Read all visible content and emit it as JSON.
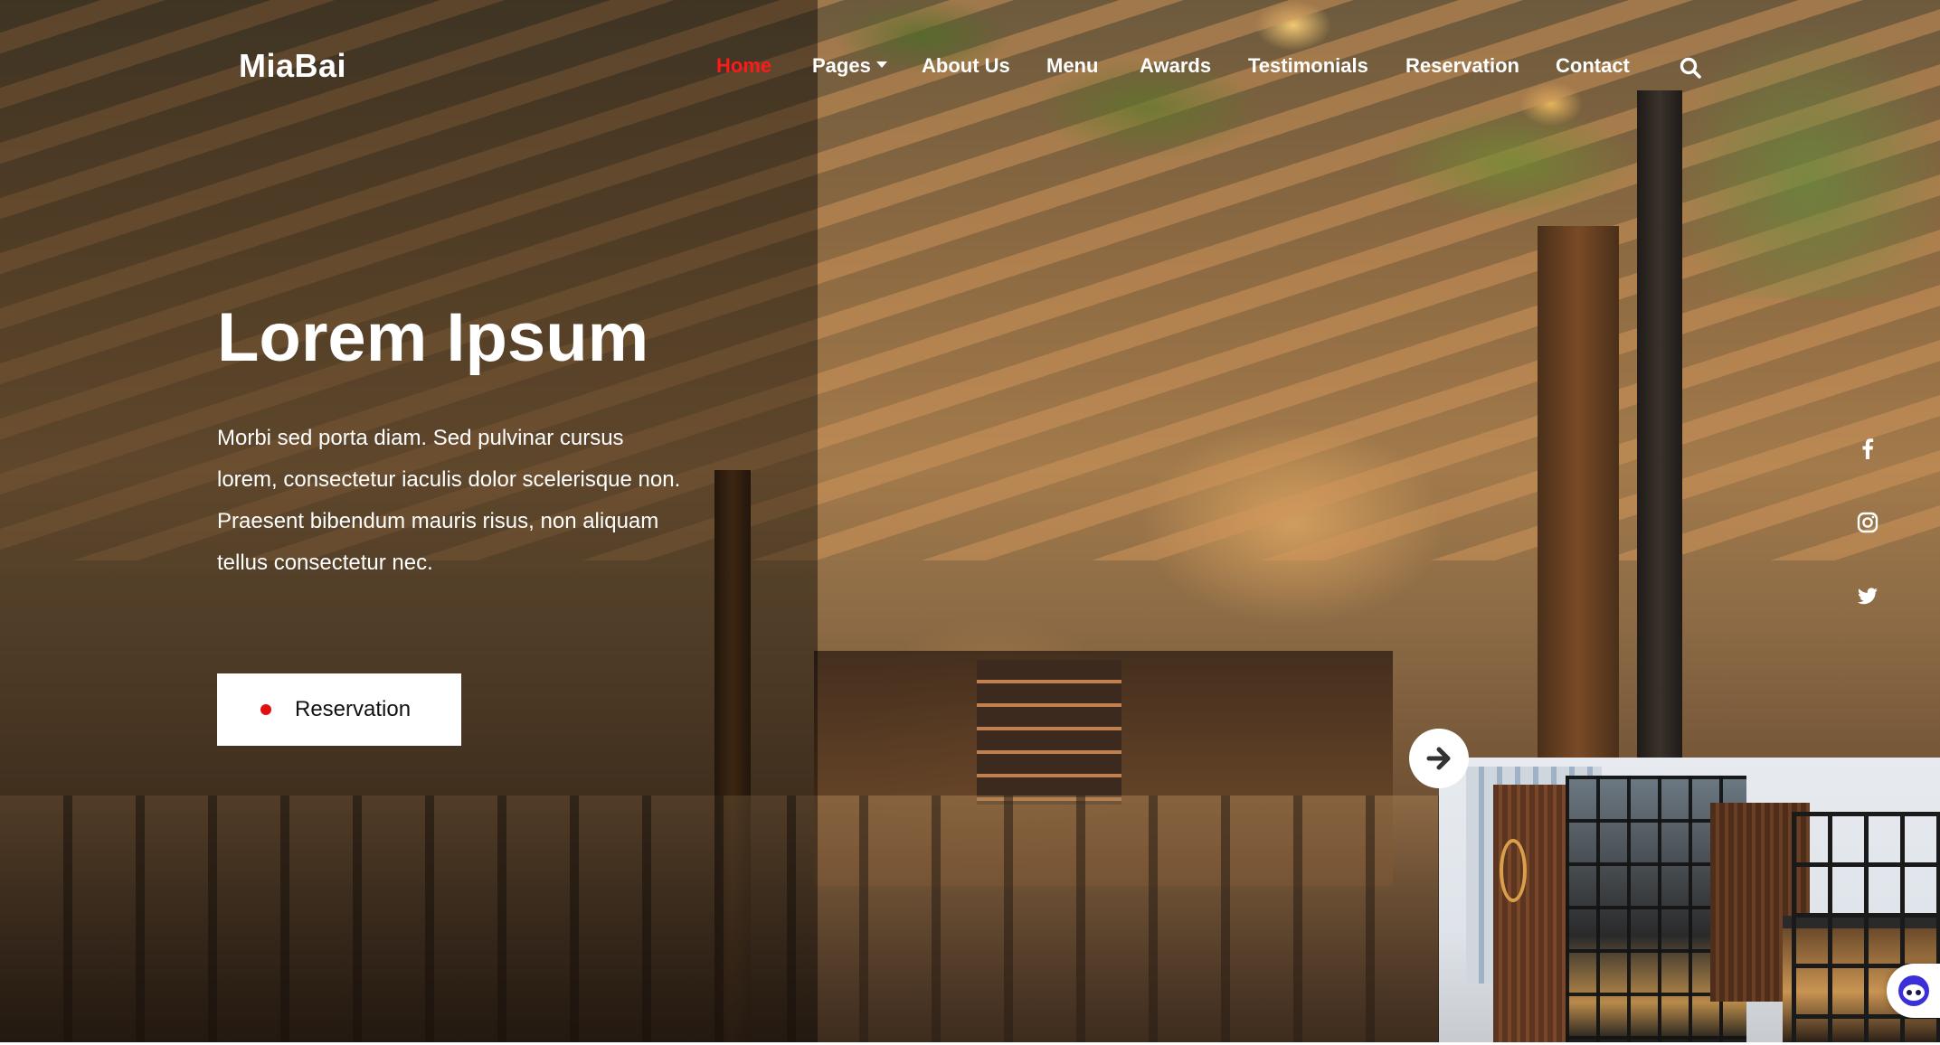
{
  "brand": {
    "logo": "MiaBai"
  },
  "nav": {
    "items": [
      {
        "label": "Home",
        "active": true
      },
      {
        "label": "Pages",
        "dropdown": true
      },
      {
        "label": "About Us"
      },
      {
        "label": "Menu"
      },
      {
        "label": "Awards"
      },
      {
        "label": "Testimonials"
      },
      {
        "label": "Reservation"
      },
      {
        "label": "Contact"
      }
    ],
    "search_icon": "search-icon"
  },
  "hero": {
    "title": "Lorem Ipsum",
    "text": "Morbi sed porta diam. Sed pulvinar cursus lorem, consectetur iaculis dolor scelerisque non. Praesent bibendum mauris risus, non aliquam tellus consectetur nec.",
    "button_label": "Reservation"
  },
  "social": {
    "icons": [
      "facebook-icon",
      "instagram-icon",
      "twitter-icon"
    ]
  },
  "slider": {
    "next_icon": "arrow-right-icon",
    "thumbnail": "restaurant-exterior-thumbnail"
  },
  "chat": {
    "icon": "chat-bot-icon"
  },
  "colors": {
    "accent": "#ff1a1a",
    "button_bg": "#ffffff",
    "button_dot": "#e01010",
    "text_light": "#ffffff"
  }
}
